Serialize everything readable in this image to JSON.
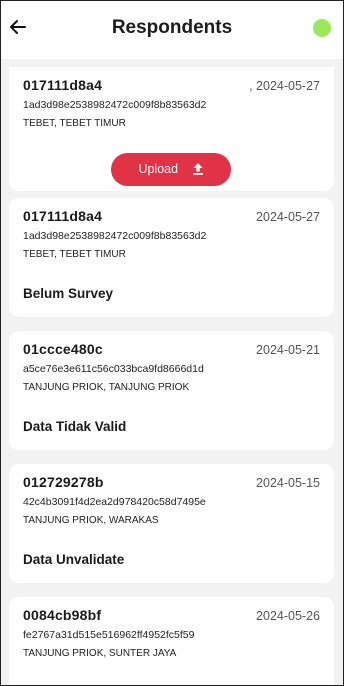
{
  "header": {
    "title": "Respondents"
  },
  "colors": {
    "status_dot": "#9be85c",
    "upload_button": "#e03345"
  },
  "icons": {
    "back": "arrow-left-icon",
    "upload": "upload-arrow-icon",
    "status": "status-dot"
  },
  "respondents": [
    {
      "code": "017111d8a4",
      "date": ", 2024-05-27",
      "hash": "1ad3d98e2538982472c009f8b83563d2",
      "location": "TEBET, TEBET TIMUR",
      "status": "",
      "upload_label": "Upload"
    },
    {
      "code": "017111d8a4",
      "date": "2024-05-27",
      "hash": "1ad3d98e2538982472c009f8b83563d2",
      "location": "TEBET, TEBET TIMUR",
      "status": "Belum Survey"
    },
    {
      "code": "01ccce480c",
      "date": "2024-05-21",
      "hash": "a5ce76e3e611c56c033bca9fd8666d1d",
      "location": "TANJUNG PRIOK, TANJUNG PRIOK",
      "status": "Data Tidak Valid"
    },
    {
      "code": "012729278b",
      "date": "2024-05-15",
      "hash": "42c4b3091f4d2ea2d978420c58d7495e",
      "location": "TANJUNG PRIOK, WARAKAS",
      "status": "Data Unvalidate"
    },
    {
      "code": "0084cb98bf",
      "date": "2024-05-26",
      "hash": "fe2767a31d515e516962ff4952fc5f59",
      "location": "TANJUNG PRIOK, SUNTER JAYA",
      "status": ""
    }
  ]
}
